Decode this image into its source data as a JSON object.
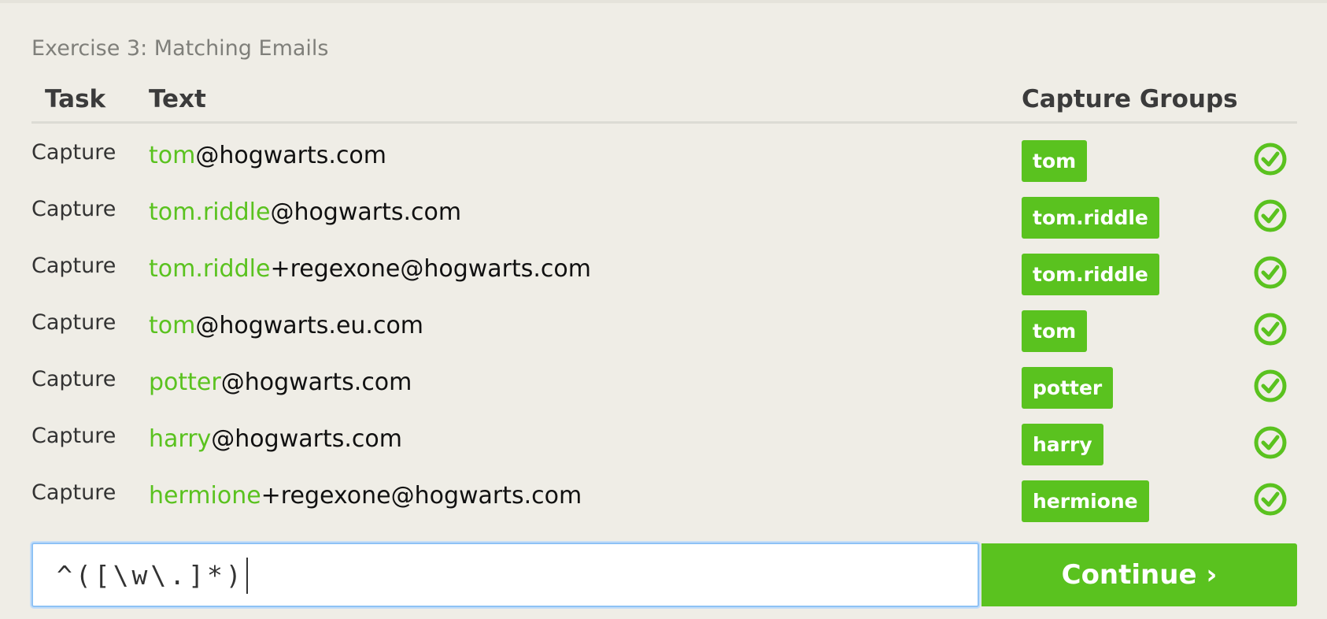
{
  "exercise_title": "Exercise 3: Matching Emails",
  "headers": {
    "task": "Task",
    "text": "Text",
    "groups": "Capture Groups"
  },
  "rows": [
    {
      "task": "Capture",
      "match": "tom",
      "rest": "@hogwarts.com",
      "group": "tom"
    },
    {
      "task": "Capture",
      "match": "tom.riddle",
      "rest": "@hogwarts.com",
      "group": "tom.riddle"
    },
    {
      "task": "Capture",
      "match": "tom.riddle",
      "rest": "+regexone@hogwarts.com",
      "group": "tom.riddle"
    },
    {
      "task": "Capture",
      "match": "tom",
      "rest": "@hogwarts.eu.com",
      "group": "tom"
    },
    {
      "task": "Capture",
      "match": "potter",
      "rest": "@hogwarts.com",
      "group": "potter"
    },
    {
      "task": "Capture",
      "match": "harry",
      "rest": "@hogwarts.com",
      "group": "harry"
    },
    {
      "task": "Capture",
      "match": "hermione",
      "rest": "+regexone@hogwarts.com",
      "group": "hermione"
    }
  ],
  "row_status_icon": "check-circle-icon",
  "regex_input": "^([\\w\\.]*)",
  "continue_label": "Continue ›",
  "accent_color": "#5ac21f"
}
